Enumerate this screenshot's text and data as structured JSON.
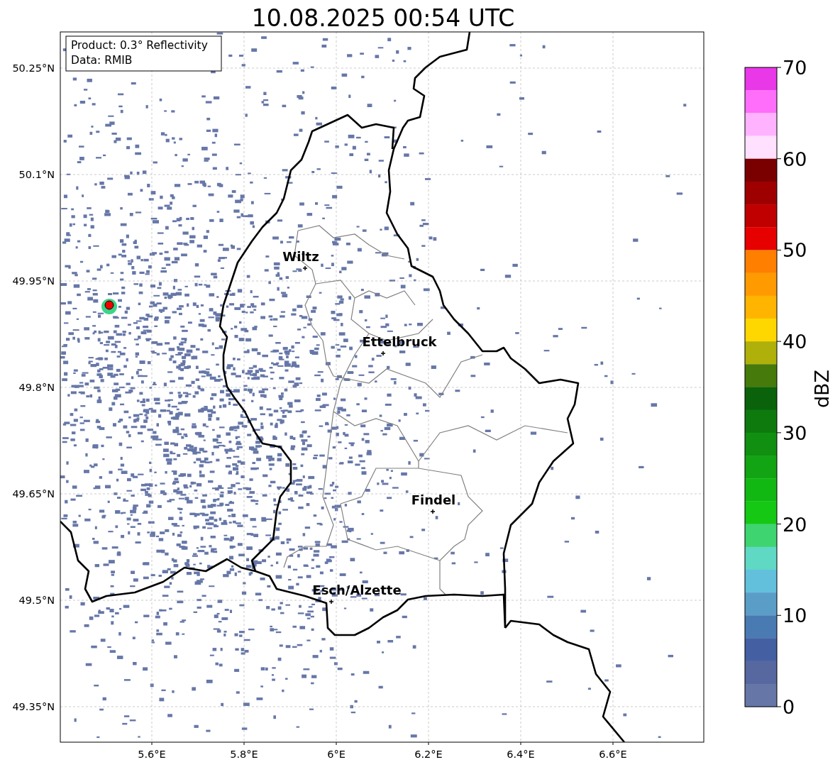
{
  "title": "10.08.2025 00:54 UTC",
  "info_box": {
    "lines": [
      "Product: 0.3° Reflectivity",
      "Data: RMIB"
    ]
  },
  "map": {
    "x_ticks": [
      "5.6°E",
      "5.8°E",
      "6°E",
      "6.2°E",
      "6.4°E",
      "6.6°E"
    ],
    "y_ticks": [
      "50.25°N",
      "50.1°N",
      "49.95°N",
      "49.8°N",
      "49.65°N",
      "49.5°N",
      "49.35°N"
    ],
    "places": [
      {
        "name": "Wiltz"
      },
      {
        "name": "Ettelbruck"
      },
      {
        "name": "Findel"
      },
      {
        "name": "Esch/Alzette"
      }
    ]
  },
  "colorbar": {
    "label": "dBZ",
    "ticks": [
      "70",
      "60",
      "50",
      "40",
      "30",
      "20",
      "10",
      "0"
    ],
    "segments": [
      {
        "color": "#e838e8"
      },
      {
        "color": "#ff6efa"
      },
      {
        "color": "#ffb3ff"
      },
      {
        "color": "#ffe0ff"
      },
      {
        "color": "#7a0000"
      },
      {
        "color": "#9e0000"
      },
      {
        "color": "#c00000"
      },
      {
        "color": "#e60000"
      },
      {
        "color": "#ff7f00"
      },
      {
        "color": "#ff9a00"
      },
      {
        "color": "#ffb500"
      },
      {
        "color": "#ffd700"
      },
      {
        "color": "#afb00a"
      },
      {
        "color": "#467a0a"
      },
      {
        "color": "#0a620a"
      },
      {
        "color": "#0e7a0e"
      },
      {
        "color": "#118f11"
      },
      {
        "color": "#12a412"
      },
      {
        "color": "#12b812"
      },
      {
        "color": "#14c814"
      },
      {
        "color": "#3ed470"
      },
      {
        "color": "#5fd8c4"
      },
      {
        "color": "#62c0dc"
      },
      {
        "color": "#5a9ec8"
      },
      {
        "color": "#4a7ab2"
      },
      {
        "color": "#4460a2"
      },
      {
        "color": "#5767a0"
      },
      {
        "color": "#6676a6"
      }
    ]
  }
}
